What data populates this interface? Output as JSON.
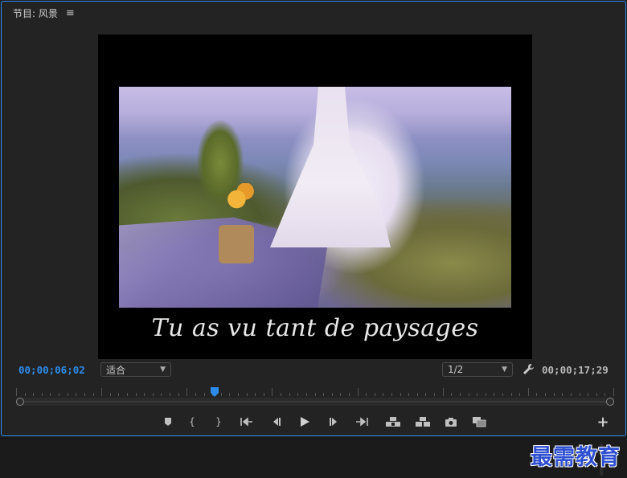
{
  "panel": {
    "title": "节目: 风景",
    "menu_icon": "hamburger-icon"
  },
  "program": {
    "subtitle": "Tu as vu tant de paysages"
  },
  "controls": {
    "current_timecode": "00;00;06;02",
    "zoom_value": "适合",
    "resolution_value": "1/2",
    "duration_timecode": "00;00;17;29",
    "settings_icon": "wrench-icon"
  },
  "transport": {
    "buttons": [
      {
        "name": "add-marker-button",
        "icon": "marker-icon"
      },
      {
        "name": "mark-in-button",
        "icon": "mark-in-icon"
      },
      {
        "name": "mark-out-button",
        "icon": "mark-out-icon"
      },
      {
        "name": "go-to-in-button",
        "icon": "go-to-in-icon"
      },
      {
        "name": "step-back-button",
        "icon": "step-back-icon"
      },
      {
        "name": "play-button",
        "icon": "play-icon"
      },
      {
        "name": "step-forward-button",
        "icon": "step-forward-icon"
      },
      {
        "name": "go-to-out-button",
        "icon": "go-to-out-icon"
      },
      {
        "name": "lift-button",
        "icon": "lift-icon"
      },
      {
        "name": "extract-button",
        "icon": "extract-icon"
      },
      {
        "name": "export-frame-button",
        "icon": "camera-icon"
      },
      {
        "name": "compare-view-button",
        "icon": "compare-icon"
      }
    ],
    "add_button_label": "+"
  },
  "colors": {
    "accent": "#2d8ceb",
    "panel_bg": "#232323",
    "canvas_bg": "#000000",
    "watermark": "#2e4fd0"
  },
  "watermark": {
    "text": "最需教育"
  }
}
